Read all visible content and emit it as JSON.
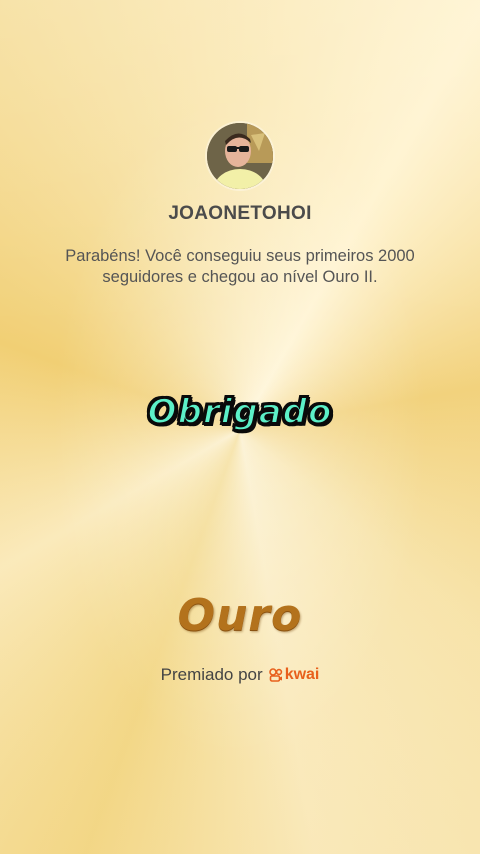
{
  "profile": {
    "username": "JOAONETOHOI"
  },
  "message": "Parabéns! Você conseguiu seus primeiros 2000 seguidores e chegou ao nível Ouro II.",
  "sticker_text": "Obrigado",
  "level_badge": "Ouro",
  "awarded": {
    "label": "Premiado por",
    "brand": "kwai"
  },
  "colors": {
    "sticker_fill": "#5cf0c8",
    "level_text": "#b3721c",
    "brand": "#e8601c"
  }
}
